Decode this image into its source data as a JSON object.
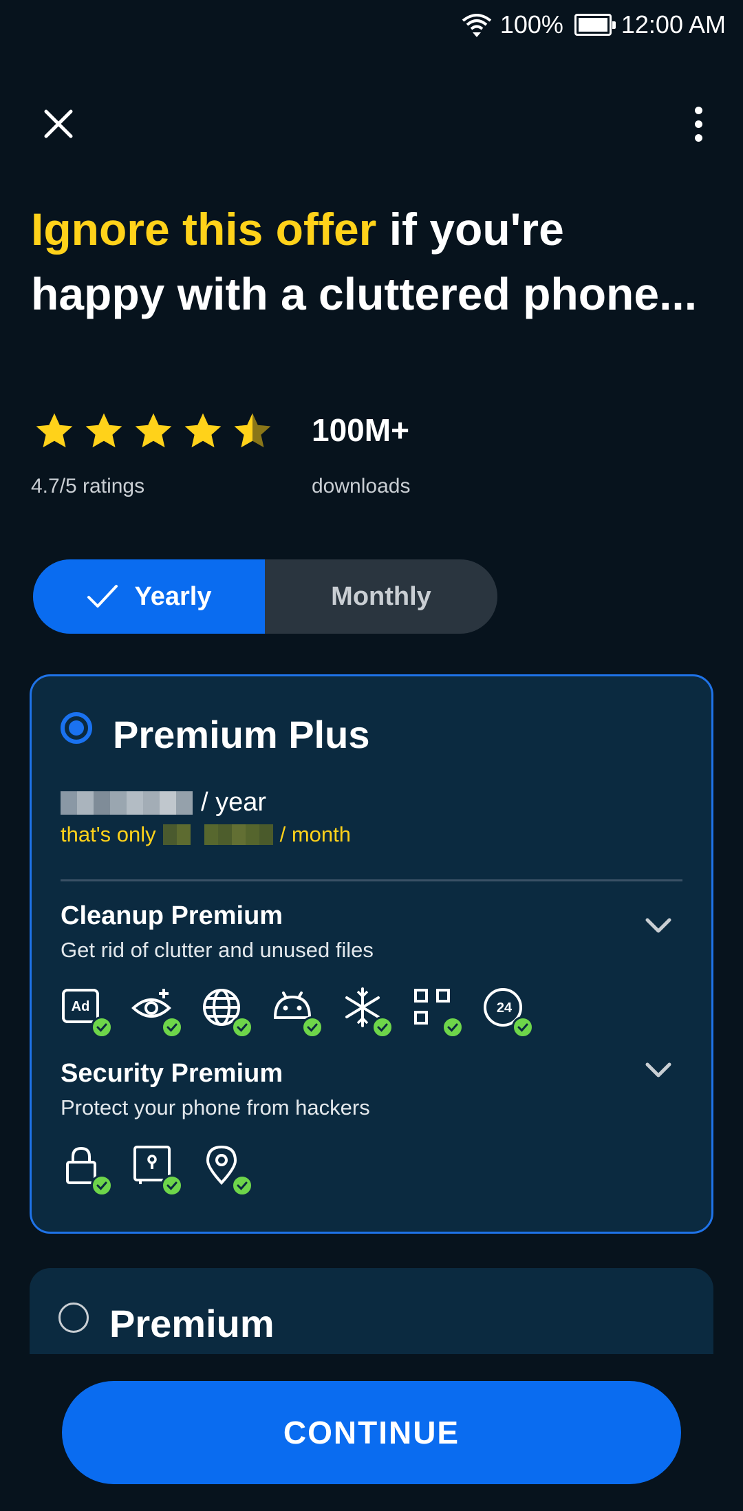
{
  "status_bar": {
    "battery": "100%",
    "time": "12:00 AM"
  },
  "headline": {
    "highlight": "Ignore this offer",
    "rest": " if you're happy with a cluttered phone..."
  },
  "rating": {
    "stars": 4.7,
    "label": "4.7/5 ratings"
  },
  "downloads": {
    "count": "100M+",
    "label": "downloads"
  },
  "billing_toggle": {
    "yearly": "Yearly",
    "monthly": "Monthly",
    "selected": "yearly"
  },
  "plans": {
    "premium_plus": {
      "title": "Premium Plus",
      "price_suffix": "/ year",
      "monthly_prefix": "that's only",
      "monthly_suffix": "/ month",
      "features": [
        {
          "title": "Cleanup Premium",
          "desc": "Get rid of clutter and unused files"
        },
        {
          "title": "Security Premium",
          "desc": "Protect your phone from hackers"
        }
      ]
    },
    "premium": {
      "title": "Premium"
    }
  },
  "icons": {
    "cleanup": [
      "ad-block-icon",
      "eye-plus-icon",
      "globe-icon",
      "android-icon",
      "snowflake-icon",
      "scan-icon",
      "support-24-icon"
    ],
    "security": [
      "lock-icon",
      "safe-icon",
      "location-pin-icon"
    ]
  },
  "colors": {
    "accent": "#0a6cf0",
    "highlight": "#ffd21a",
    "check": "#6ed54a"
  },
  "cta": {
    "label": "CONTINUE"
  }
}
